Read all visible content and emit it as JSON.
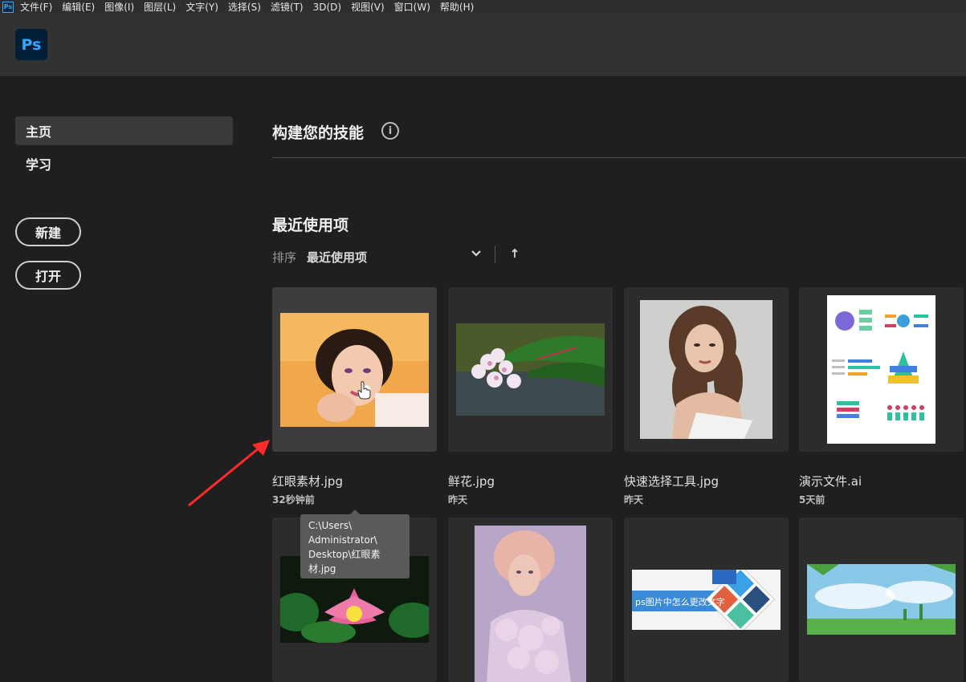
{
  "menubar": {
    "app_icon": "Ps",
    "items": [
      "文件(F)",
      "编辑(E)",
      "图像(I)",
      "图层(L)",
      "文字(Y)",
      "选择(S)",
      "滤镜(T)",
      "3D(D)",
      "视图(V)",
      "窗口(W)",
      "帮助(H)"
    ]
  },
  "logo": "Ps",
  "sidebar": {
    "home": "主页",
    "learn": "学习",
    "new_button": "新建",
    "open_button": "打开"
  },
  "skills": {
    "title": "构建您的技能",
    "info_icon": "i"
  },
  "recent": {
    "title": "最近使用项",
    "sort_label": "排序",
    "sort_value": "最近使用项",
    "chevron_icon": "chevron-down-icon",
    "sort_direction_icon": "arrow-up-icon"
  },
  "files": [
    {
      "name": "红眼素材.jpg",
      "time": "32秒钟前"
    },
    {
      "name": "鲜花.jpg",
      "time": "昨天"
    },
    {
      "name": "快速选择工具.jpg",
      "time": "昨天"
    },
    {
      "name": "演示文件.ai",
      "time": "5天前"
    },
    {
      "name": "",
      "time": ""
    },
    {
      "name": "",
      "time": ""
    },
    {
      "name": "",
      "time": ""
    },
    {
      "name": "",
      "time": ""
    }
  ],
  "thumb_text": {
    "banner": "ps图片中怎么更改文字"
  },
  "tooltip": {
    "line1": "C:\\Users\\",
    "line2": "Administrator\\",
    "line3": "Desktop\\红眼素",
    "line4": "材.jpg"
  },
  "colors": {
    "accent": "#31a8ff",
    "background": "#1f1f1f",
    "annotation_arrow": "#ff2a2a"
  }
}
